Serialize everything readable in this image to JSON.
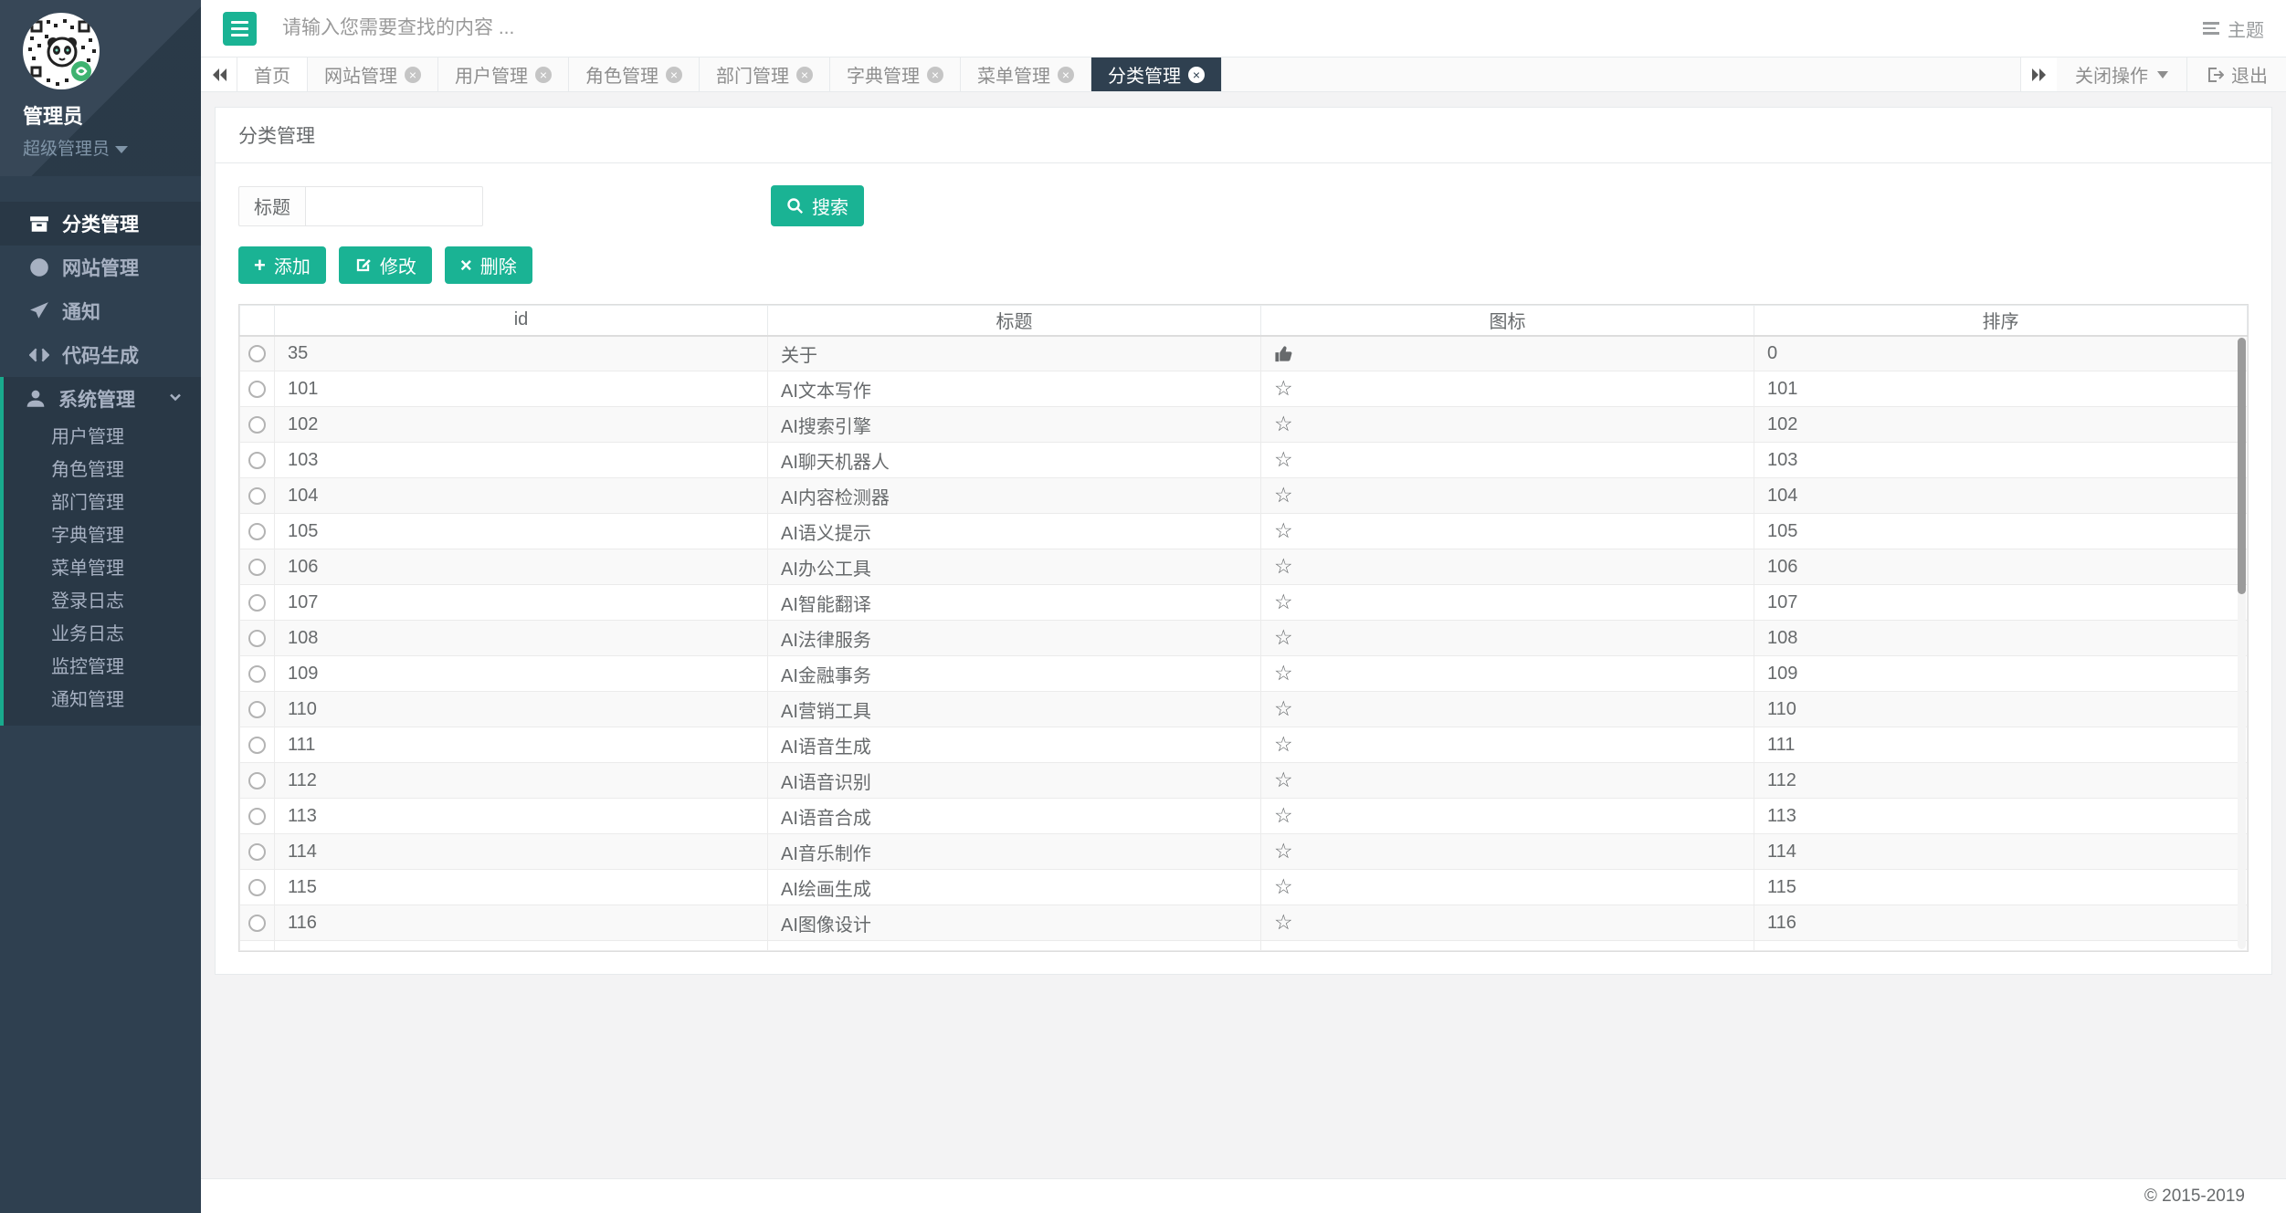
{
  "colors": {
    "accent_green": "#1ab394",
    "sidebar_bg": "#2f4050",
    "sidebar_active_bg": "#293846",
    "active_border_green": "#19aa8d",
    "page_bg": "#f3f3f4",
    "border": "#e7eaec"
  },
  "sidebar": {
    "user": {
      "name": "管理员",
      "role": "超级管理员",
      "avatar": "qr-panda-avatar"
    },
    "menu": [
      {
        "label": "分类管理",
        "icon": "archive-icon",
        "active": true,
        "expanded": false,
        "children": []
      },
      {
        "label": "网站管理",
        "icon": "globe-icon",
        "active": false,
        "expanded": false,
        "children": []
      },
      {
        "label": "通知",
        "icon": "paper-plane-icon",
        "active": false,
        "expanded": false,
        "children": []
      },
      {
        "label": "代码生成",
        "icon": "code-icon",
        "active": false,
        "expanded": false,
        "children": []
      },
      {
        "label": "系统管理",
        "icon": "user-icon",
        "active": false,
        "expanded": true,
        "children": [
          "用户管理",
          "角色管理",
          "部门管理",
          "字典管理",
          "菜单管理",
          "登录日志",
          "业务日志",
          "监控管理",
          "通知管理"
        ]
      }
    ]
  },
  "topbar": {
    "search_placeholder": "请输入您需要查找的内容 ...",
    "search_value": "",
    "theme_label": "主题"
  },
  "tabbar": {
    "tabs": [
      {
        "label": "首页",
        "closable": false,
        "active": false
      },
      {
        "label": "网站管理",
        "closable": true,
        "active": false
      },
      {
        "label": "用户管理",
        "closable": true,
        "active": false
      },
      {
        "label": "角色管理",
        "closable": true,
        "active": false
      },
      {
        "label": "部门管理",
        "closable": true,
        "active": false
      },
      {
        "label": "字典管理",
        "closable": true,
        "active": false
      },
      {
        "label": "菜单管理",
        "closable": true,
        "active": false
      },
      {
        "label": "分类管理",
        "closable": true,
        "active": true
      }
    ],
    "close_ops_label": "关闭操作",
    "logout_label": "退出"
  },
  "panel": {
    "title": "分类管理"
  },
  "search_form": {
    "field_label": "标题",
    "field_value": "",
    "search_button_label": "搜索"
  },
  "toolbar": {
    "add_label": "添加",
    "edit_label": "修改",
    "delete_label": "删除"
  },
  "table": {
    "columns": [
      "id",
      "标题",
      "图标",
      "排序"
    ],
    "rows": [
      {
        "id": "35",
        "title": "关于",
        "icon": "thumbs-up-icon",
        "order": "0"
      },
      {
        "id": "101",
        "title": "AI文本写作",
        "icon": "star-outline-icon",
        "order": "101"
      },
      {
        "id": "102",
        "title": "AI搜索引擎",
        "icon": "star-outline-icon",
        "order": "102"
      },
      {
        "id": "103",
        "title": "AI聊天机器人",
        "icon": "star-outline-icon",
        "order": "103"
      },
      {
        "id": "104",
        "title": "AI内容检测器",
        "icon": "star-outline-icon",
        "order": "104"
      },
      {
        "id": "105",
        "title": "AI语义提示",
        "icon": "star-outline-icon",
        "order": "105"
      },
      {
        "id": "106",
        "title": "AI办公工具",
        "icon": "star-outline-icon",
        "order": "106"
      },
      {
        "id": "107",
        "title": "AI智能翻译",
        "icon": "star-outline-icon",
        "order": "107"
      },
      {
        "id": "108",
        "title": "AI法律服务",
        "icon": "star-outline-icon",
        "order": "108"
      },
      {
        "id": "109",
        "title": "AI金融事务",
        "icon": "star-outline-icon",
        "order": "109"
      },
      {
        "id": "110",
        "title": "AI营销工具",
        "icon": "star-outline-icon",
        "order": "110"
      },
      {
        "id": "111",
        "title": "AI语音生成",
        "icon": "star-outline-icon",
        "order": "111"
      },
      {
        "id": "112",
        "title": "AI语音识别",
        "icon": "star-outline-icon",
        "order": "112"
      },
      {
        "id": "113",
        "title": "AI语音合成",
        "icon": "star-outline-icon",
        "order": "113"
      },
      {
        "id": "114",
        "title": "AI音乐制作",
        "icon": "star-outline-icon",
        "order": "114"
      },
      {
        "id": "115",
        "title": "AI绘画生成",
        "icon": "star-outline-icon",
        "order": "115"
      },
      {
        "id": "116",
        "title": "AI图像设计",
        "icon": "star-outline-icon",
        "order": "116"
      }
    ]
  },
  "footer": {
    "copyright": "© 2015-2019"
  }
}
